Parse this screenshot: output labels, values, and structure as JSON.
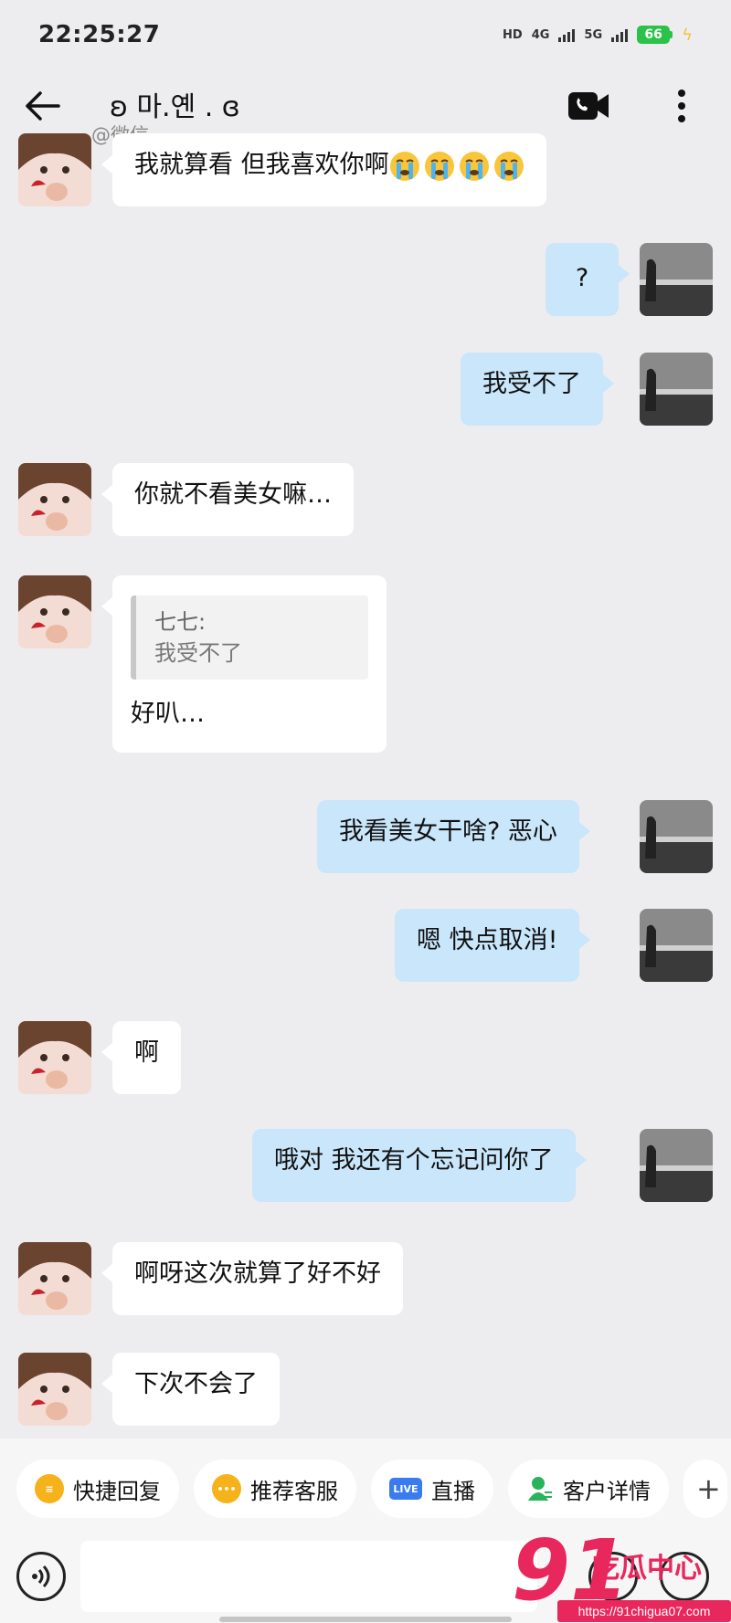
{
  "status_bar": {
    "time": "22:25:27",
    "network_hd": "HD",
    "network_4g": "4G",
    "network_5g": "5G",
    "battery": "66"
  },
  "header": {
    "contact_name": "ʚ 마.옌 . ɞ",
    "contact_source": "@微信"
  },
  "messages": [
    {
      "side": "left",
      "text": "我就算看 但我喜欢你啊",
      "emoji_count": 4
    },
    {
      "side": "right",
      "text": "?"
    },
    {
      "side": "right",
      "text": "我受不了"
    },
    {
      "side": "left",
      "text": "你就不看美女嘛…"
    },
    {
      "side": "left",
      "quote_name": "七七:",
      "quote_text": "我受不了",
      "text": "好叭…"
    },
    {
      "side": "right",
      "text": "我看美女干啥? 恶心"
    },
    {
      "side": "right",
      "text": "嗯 快点取消!"
    },
    {
      "side": "left",
      "text": "啊"
    },
    {
      "side": "right",
      "text": "哦对 我还有个忘记问你了"
    },
    {
      "side": "left",
      "text": "啊呀这次就算了好不好"
    },
    {
      "side": "left",
      "text": "下次不会了"
    }
  ],
  "quick_actions": [
    {
      "label": "快捷回复",
      "icon": "quick-reply-icon",
      "color": "#f5b21a"
    },
    {
      "label": "推荐客服",
      "icon": "recommend-service-icon",
      "color": "#f5b21a"
    },
    {
      "label": "直播",
      "icon": "live-icon",
      "color": "#3a7bf0",
      "badge": "LIVE"
    },
    {
      "label": "客户详情",
      "icon": "customer-detail-icon",
      "color": "#29b35a"
    }
  ],
  "watermark": {
    "number": "91",
    "title": "吃瓜中心",
    "url": "https://91chigua07.com"
  },
  "colors": {
    "background": "#ededf0",
    "bubble_right": "#c9e6fb",
    "bubble_left": "#ffffff",
    "watermark": "#e8275c"
  }
}
